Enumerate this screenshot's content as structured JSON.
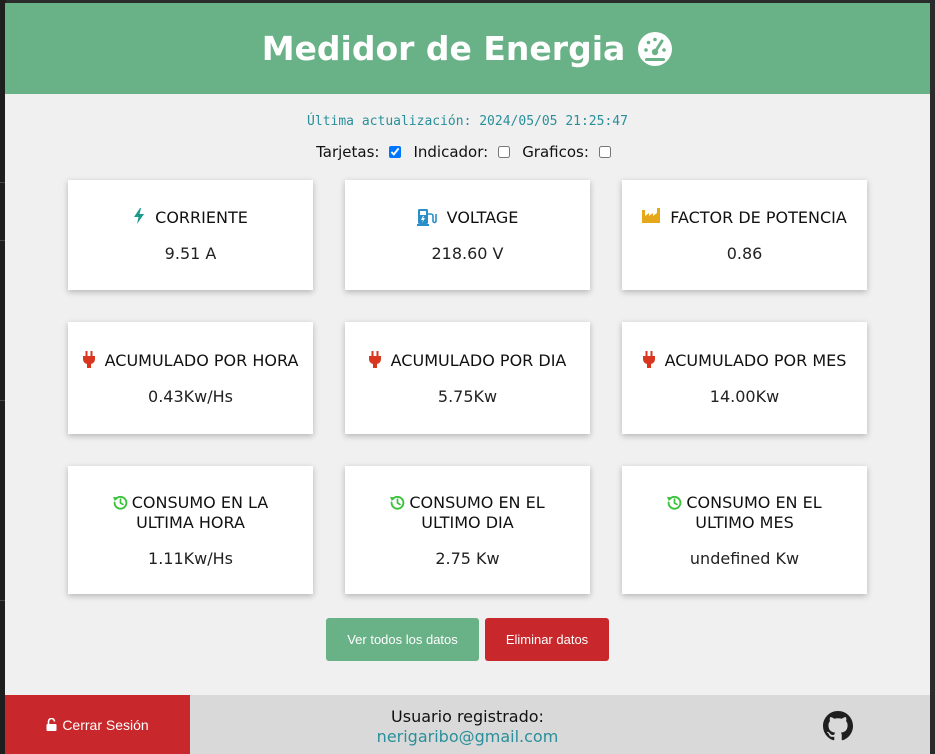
{
  "app": {
    "title": "Medidor de Energia",
    "icon": "gauge-icon",
    "last_update_label": "Última actualización: 2024/05/05 21:25:47"
  },
  "toggles": {
    "cards_label": "Tarjetas:",
    "cards_checked": true,
    "indicator_label": "Indicador:",
    "indicator_checked": false,
    "charts_label": "Graficos:",
    "charts_checked": false
  },
  "cards": [
    {
      "name": "corriente",
      "icon": "bolt-icon",
      "title": "CORRIENTE",
      "value": "9.51 A"
    },
    {
      "name": "voltage",
      "icon": "charging-station-icon",
      "title": "VOLTAGE",
      "value": "218.60 V"
    },
    {
      "name": "factor-potencia",
      "icon": "industry-icon",
      "title": "FACTOR DE POTENCIA",
      "value": "0.86"
    },
    {
      "name": "acumulado-hora",
      "icon": "plug-icon",
      "title": "ACUMULADO POR HORA",
      "value": "0.43Kw/Hs"
    },
    {
      "name": "acumulado-dia",
      "icon": "plug-icon",
      "title": "ACUMULADO POR DIA",
      "value": "5.75Kw"
    },
    {
      "name": "acumulado-mes",
      "icon": "plug-icon",
      "title": "ACUMULADO POR MES",
      "value": "14.00Kw"
    },
    {
      "name": "consumo-hora",
      "icon": "history-icon",
      "title_line1": "CONSUMO EN LA",
      "title_line2": "ULTIMA HORA",
      "value": "1.11Kw/Hs"
    },
    {
      "name": "consumo-dia",
      "icon": "history-icon",
      "title_line1": "CONSUMO EN EL",
      "title_line2": "ULTIMO DIA",
      "value": "2.75 Kw"
    },
    {
      "name": "consumo-mes",
      "icon": "history-icon",
      "title_line1": "CONSUMO EN EL",
      "title_line2": "ULTIMO MES",
      "value": "undefined Kw"
    }
  ],
  "buttons": {
    "view_all": "Ver todos los datos",
    "delete": "Eliminar datos"
  },
  "footer": {
    "logout_label": "Cerrar Sesión",
    "user_label": "Usuario registrado:",
    "user_email": "nerigaribo@gmail.com",
    "github_icon": "github-icon"
  },
  "colors": {
    "header": "#69b186",
    "danger": "#c8282b",
    "accent_text": "#2a8f9a",
    "bolt": "#1a9a8a",
    "plug": "#d9361f",
    "history": "#39c23a",
    "industry": "#e5a81a"
  }
}
